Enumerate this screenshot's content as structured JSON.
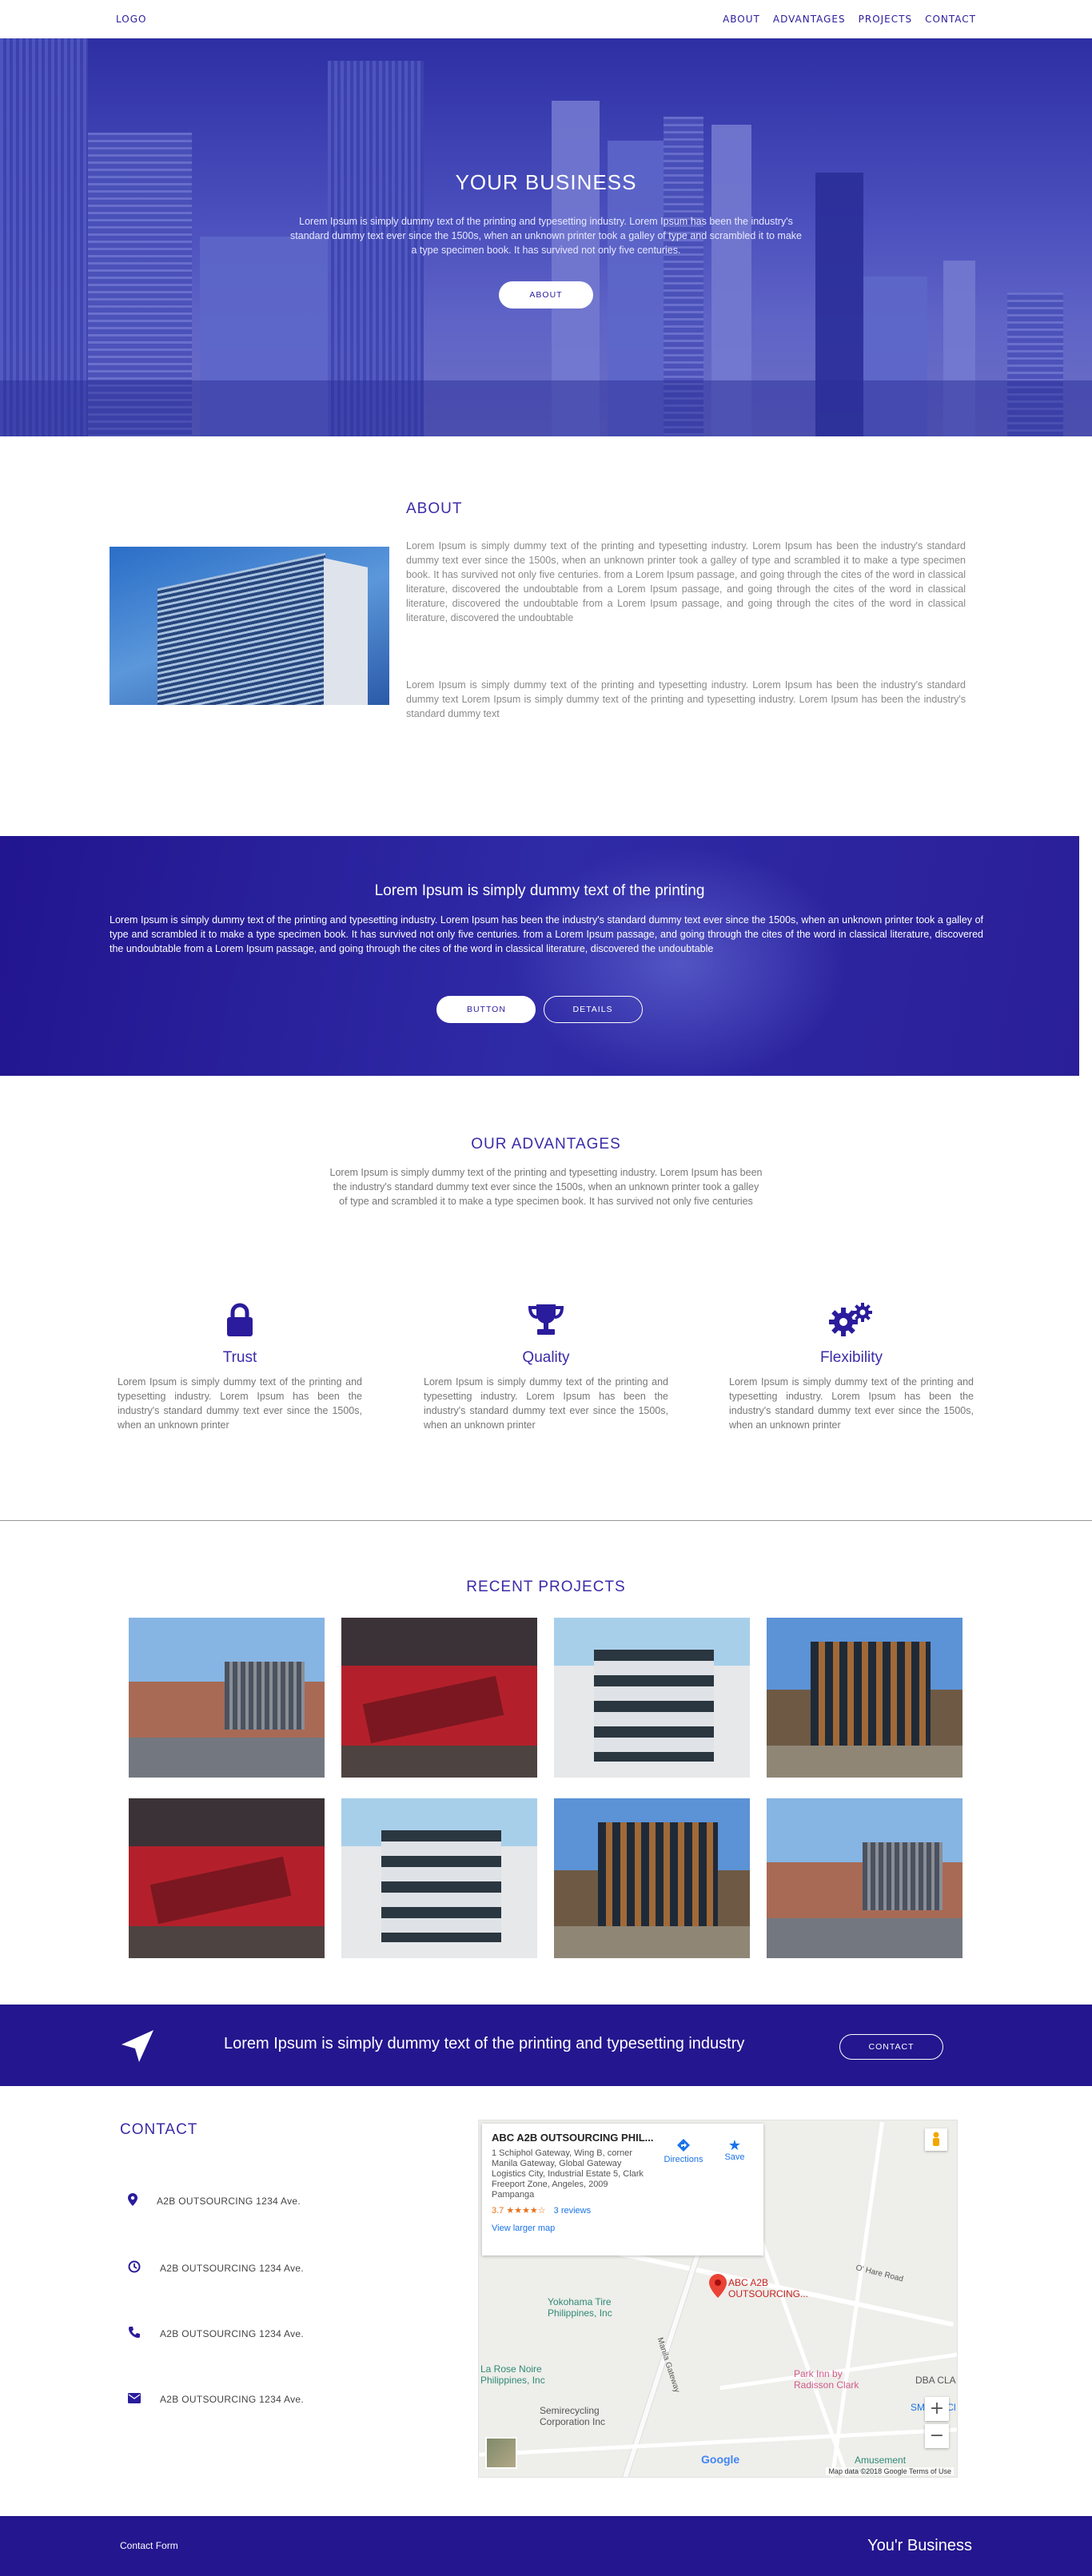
{
  "nav": {
    "logo": "LOGO",
    "links": [
      "ABOUT",
      "ADVANTAGES",
      "PROJECTS",
      "CONTACT"
    ]
  },
  "hero": {
    "title": "YOUR BUSINESS",
    "text": "Lorem Ipsum is simply dummy text of the printing and typesetting industry. Lorem Ipsum has been the industry's standard dummy text ever since the 1500s, when an unknown printer took a galley of type and scrambled it to make a type specimen book. It has survived not only five centuries.",
    "button": "ABOUT"
  },
  "about": {
    "title": "ABOUT",
    "p1": "Lorem Ipsum is simply dummy text of the printing and typesetting industry. Lorem Ipsum has been the industry's standard dummy text ever since the 1500s, when an unknown printer took a galley of type and scrambled it to make a type specimen book. It has survived not only five centuries. from a Lorem Ipsum passage, and going through the cites of the word in classical literature, discovered the undoubtable from a Lorem Ipsum passage, and going through the cites of the word in classical literature, discovered the undoubtable from a Lorem Ipsum passage, and going through the cites of the word in classical literature, discovered the undoubtable",
    "p2": "Lorem Ipsum is simply dummy text of the printing and typesetting industry. Lorem Ipsum has been the industry's standard dummy text Lorem Ipsum is simply dummy text of the printing and typesetting industry. Lorem Ipsum has been the industry's standard dummy text"
  },
  "banner": {
    "title": "Lorem Ipsum is simply dummy text of the printing",
    "text": "Lorem Ipsum is simply dummy text of the printing and typesetting industry. Lorem Ipsum has been the industry's standard dummy text ever since the 1500s, when an unknown printer took a galley of type and scrambled it to make a type specimen book. It has survived not only five centuries. from a Lorem Ipsum passage, and going through the cites of the word in classical literature, discovered the undoubtable from a Lorem Ipsum passage, and going through the cites of the word in classical literature, discovered the undoubtable",
    "button1": "BUTTON",
    "button2": "DETAILS"
  },
  "advantages": {
    "title": "OUR ADVANTAGES",
    "intro": "Lorem Ipsum is simply dummy text of the printing and typesetting industry. Lorem Ipsum has been the industry's standard dummy text ever since the 1500s, when an unknown printer took a galley of type and scrambled it to make a type specimen book. It has survived not only five centuries",
    "items": [
      {
        "icon": "lock-icon",
        "title": "Trust",
        "text": "Lorem Ipsum is simply dummy text of the printing and typesetting industry. Lorem Ipsum has been the industry's standard dummy text ever since the 1500s, when an unknown printer"
      },
      {
        "icon": "trophy-icon",
        "title": "Quality",
        "text": "Lorem Ipsum is simply dummy text of the printing and typesetting industry. Lorem Ipsum has been the industry's standard dummy text ever since the 1500s, when an unknown printer"
      },
      {
        "icon": "gears-icon",
        "title": "Flexibility",
        "text": "Lorem Ipsum is simply dummy text of the printing and typesetting industry. Lorem Ipsum has been the industry's standard dummy text ever since the 1500s, when an unknown printer"
      }
    ]
  },
  "projects": {
    "title": "RECENT PROJECTS"
  },
  "cta": {
    "text": "Lorem Ipsum is simply dummy text of the printing and typesetting industry",
    "button": "CONTACT"
  },
  "contact": {
    "title": "CONTACT",
    "rows": [
      {
        "icon": "map-marker-icon",
        "text": "A2B OUTSOURCING 1234 Ave."
      },
      {
        "icon": "clock-icon",
        "text": "A2B OUTSOURCING 1234 Ave."
      },
      {
        "icon": "phone-icon",
        "text": "A2B OUTSOURCING 1234 Ave."
      },
      {
        "icon": "envelope-icon",
        "text": "A2B OUTSOURCING 1234 Ave."
      }
    ]
  },
  "map": {
    "place_name": "ABC A2B OUTSOURCING PHIL...",
    "address": "1 Schiphol Gateway, Wing B, corner Manila Gateway, Global Gateway Logistics City, Industrial Estate 5, Clark Freeport Zone, Angeles, 2009 Pampanga",
    "rating": "3.7 ★★★★☆",
    "reviews": "3 reviews",
    "larger_map": "View larger map",
    "directions": "Directions",
    "save": "Save",
    "pin_label": "ABC A2B OUTSOURCING...",
    "poi_1": "Yokohama Tire Philippines, Inc",
    "poi_2": "La Rose Noire Philippines, Inc",
    "poi_3": "Semirecycling Corporation Inc",
    "poi_4": "Park Inn by Radisson Clark",
    "poi_5": "DBA CLA",
    "poi_6": "SM City Cl",
    "poi_7": "Amusement Park",
    "road_1": "Manila Gateway",
    "road_2": "O' Hare Road",
    "zoom_in": "+",
    "zoom_out": "−",
    "google": "Google",
    "attribution": "Map data ©2018 Google  Terms of Use"
  },
  "footer": {
    "left": "Contact Form",
    "right": "You'r Business"
  }
}
